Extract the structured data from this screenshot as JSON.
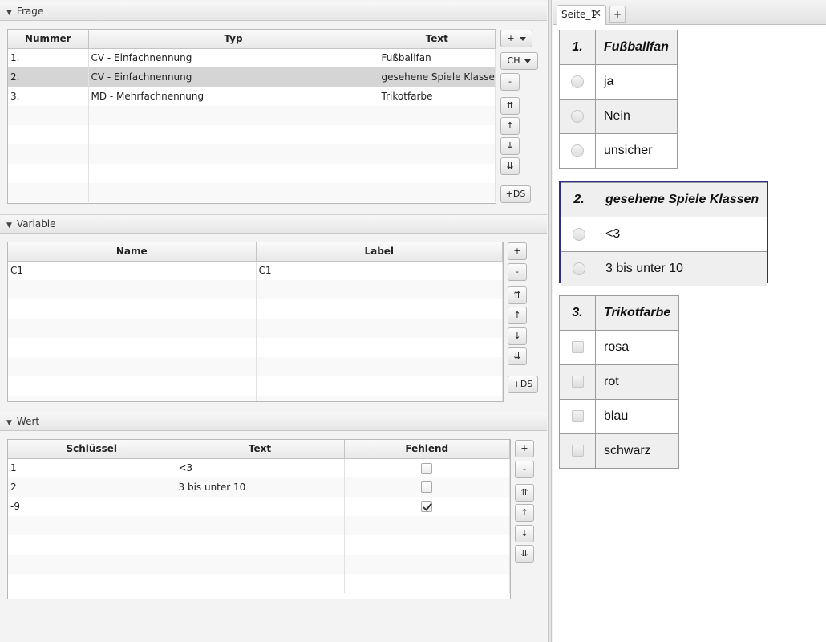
{
  "frage": {
    "header": "Frage",
    "columns": [
      "Nummer",
      "Typ",
      "Text"
    ],
    "rows": [
      {
        "nummer": "1.",
        "typ": "CV - Einfachnennung",
        "text": "Fußballfan"
      },
      {
        "nummer": "2.",
        "typ": "CV - Einfachnennung",
        "text": "gesehene Spiele Klassen"
      },
      {
        "nummer": "3.",
        "typ": "MD - Mehrfachnennung",
        "text": "Trikotfarbe"
      }
    ],
    "buttons": {
      "add": "+",
      "ch": "CH",
      "remove": "-",
      "top": "⇈",
      "up": "↑",
      "down": "↓",
      "bottom": "⇊",
      "ds": "+DS"
    }
  },
  "variable": {
    "header": "Variable",
    "columns": [
      "Name",
      "Label"
    ],
    "rows": [
      {
        "name": "C1",
        "label": "C1"
      }
    ],
    "buttons": {
      "add": "+",
      "remove": "-",
      "top": "⇈",
      "up": "↑",
      "down": "↓",
      "bottom": "⇊",
      "ds": "+DS"
    }
  },
  "wert": {
    "header": "Wert",
    "columns": [
      "Schlüssel",
      "Text",
      "Fehlend"
    ],
    "rows": [
      {
        "schluessel": "1",
        "text": "<3",
        "fehlend": false
      },
      {
        "schluessel": "2",
        "text": "3 bis unter 10",
        "fehlend": false
      },
      {
        "schluessel": "-9",
        "text": "",
        "fehlend": true
      }
    ],
    "buttons": {
      "add": "+",
      "remove": "-",
      "top": "⇈",
      "up": "↑",
      "down": "↓",
      "bottom": "⇊"
    }
  },
  "preview": {
    "tab_label": "Seite_1",
    "tab_close": "✕",
    "tab_add": "+",
    "questions": [
      {
        "num": "1.",
        "title": "Fußballfan",
        "input": "radio",
        "options": [
          "ja",
          "Nein",
          "unsicher"
        ]
      },
      {
        "num": "2.",
        "title": "gesehene Spiele Klassen",
        "input": "radio",
        "options": [
          "<3",
          "3 bis unter 10"
        ]
      },
      {
        "num": "3.",
        "title": "Trikotfarbe",
        "input": "checkbox",
        "options": [
          "rosa",
          "rot",
          "blau",
          "schwarz"
        ]
      }
    ]
  },
  "colors": {
    "selection_border": "#2e2e8a",
    "selected_row": "#d5d5d5"
  }
}
